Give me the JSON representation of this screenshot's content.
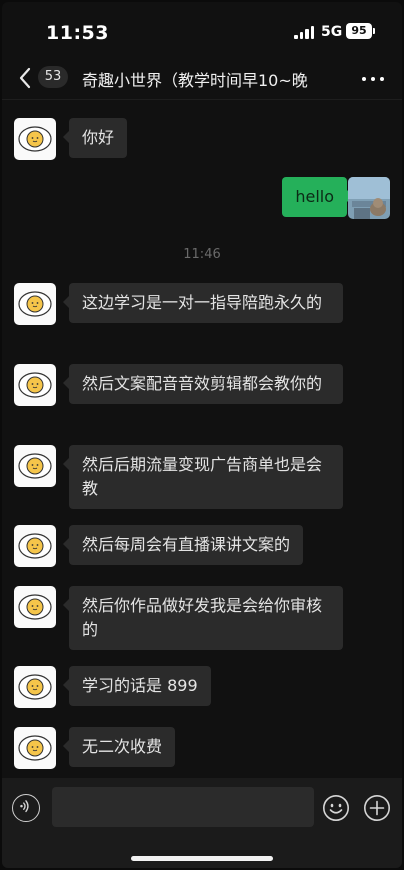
{
  "status_bar": {
    "time": "11:53",
    "network": "5G",
    "battery": "95"
  },
  "nav": {
    "back_icon": "chevron-left-icon",
    "unread_count": "53",
    "title": "奇趣小世界（教学时间早10~晚",
    "more_icon": "more-dots-icon"
  },
  "messages": [
    {
      "sender": "other",
      "text": "你好"
    },
    {
      "sender": "me",
      "text": "hello"
    },
    {
      "type": "timestamp",
      "text": "11:46"
    },
    {
      "sender": "other",
      "text": "这边学习是一对一指导陪跑永久的"
    },
    {
      "sender": "other",
      "text": "然后文案配音音效剪辑都会教你的"
    },
    {
      "sender": "other",
      "text": "然后后期流量变现广告商单也是会教"
    },
    {
      "sender": "other",
      "text": "然后每周会有直播课讲文案的"
    },
    {
      "sender": "other",
      "text": "然后你作品做好发我是会给你审核的"
    },
    {
      "sender": "other",
      "text": "学习的话是 899"
    },
    {
      "sender": "other",
      "text": "无二次收费"
    }
  ],
  "input_bar": {
    "voice_icon": "voice-icon",
    "input_value": "",
    "emoji_icon": "emoji-icon",
    "plus_icon": "plus-icon"
  },
  "colors": {
    "background": "#111111",
    "bubble_other": "#2b2b2b",
    "bubble_me": "#25b05a",
    "timestamp": "#6a6a6a"
  }
}
